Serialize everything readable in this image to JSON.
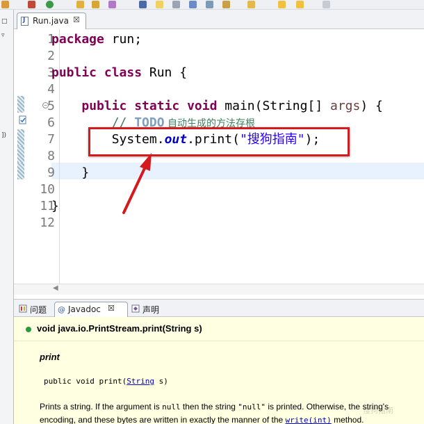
{
  "editor": {
    "tab_label": "Run.java",
    "close_glyph": "☒",
    "line_numbers": [
      "1",
      "2",
      "3",
      "4",
      "5",
      "6",
      "7",
      "8",
      "9",
      "10",
      "11",
      "12"
    ],
    "code": {
      "l1_kw": "package",
      "l1_rest": " run;",
      "l3_kw": "public class",
      "l3_rest": " Run {",
      "l5_indent": "    ",
      "l5_kw": "public static void",
      "l5_mid": " main(String[] ",
      "l5_param": "args",
      "l5_end": ") {",
      "l6_indent": "        ",
      "l6_slashes": "// ",
      "l6_todo": "TODO",
      "l6_text": " 自动生成的方法存根",
      "l7_indent": "        ",
      "l7_a": "System.",
      "l7_field": "out",
      "l7_b": ".print(",
      "l7_str": "\"搜狗指南\"",
      "l7_c": ");",
      "l9": "    }",
      "l11": "}"
    }
  },
  "views": {
    "tabs": [
      {
        "label": "问题"
      },
      {
        "label": "Javadoc"
      },
      {
        "label": "声明"
      }
    ]
  },
  "javadoc": {
    "signature": "void java.io.PrintStream.print(String s)",
    "method_name": "print",
    "code_prefix": "public void print(",
    "code_link": "String",
    "code_suffix": " s)",
    "desc1_a": "Prints a string. If the argument is ",
    "desc1_null": "null",
    "desc1_b": " then the string ",
    "desc1_nullq": "\"null\"",
    "desc1_c": " is printed. Otherwise, the string's",
    "desc2_a": "encoding, and these bytes are written in exactly the manner of the ",
    "desc2_link": "write(int)",
    "desc2_b": " method."
  },
  "watermark": "搜狗指南",
  "colors": {
    "keyword": "#7f0055",
    "string": "#2a00ff",
    "field": "#0000c0",
    "comment": "#3f7f5f",
    "annotation_red": "#d41a1f",
    "javadoc_bg": "#ffffe1"
  },
  "icons": [
    "java-file-icon",
    "close-icon",
    "problems-icon",
    "javadoc-icon",
    "declaration-icon",
    "bullet-icon",
    "fold-icon",
    "todo-marker-icon",
    "red-arrow-icon"
  ]
}
